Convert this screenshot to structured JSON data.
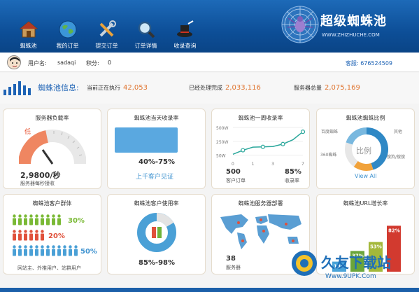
{
  "nav": [
    {
      "label": "蜘蛛池",
      "icon": "house-icon"
    },
    {
      "label": "我的订单",
      "icon": "globe-icon"
    },
    {
      "label": "提交订单",
      "icon": "tools-icon"
    },
    {
      "label": "订单详情",
      "icon": "magnifier-icon"
    },
    {
      "label": "收录查询",
      "icon": "magic-hat-icon"
    }
  ],
  "brand": {
    "title": "超级蜘蛛池",
    "url": "WWW.ZHIZHUCHE.COM"
  },
  "user": {
    "name_label": "用户名:",
    "name": "sadaqi",
    "points_label": "积分:",
    "points": "0",
    "service_label": "客服:",
    "service_qq": "676524509"
  },
  "info": {
    "title": "蜘蛛池信息:",
    "running_label": "当前正在执行",
    "running": "42,053",
    "done_label": "已经处理完成",
    "done": "2,033,116",
    "total_label": "服务器总量",
    "total": "2,075,169"
  },
  "cards": {
    "load": {
      "title": "服务器负载率",
      "level": "低",
      "value": "2,9800/秒",
      "sub": "服务器每秒接收"
    },
    "daily": {
      "title": "蜘蛛池当天收录率",
      "range": "40%-75%",
      "link": "上千客户见证"
    },
    "weekly": {
      "title": "蜘蛛池一周收录率",
      "orders": "500",
      "orders_label": "客户订单",
      "rate": "85%",
      "rate_label": "收录率"
    },
    "ratio": {
      "title": "蜘蛛池蜘蛛比例",
      "center": "比例",
      "l1": "百度蜘蛛",
      "l2": "其他",
      "l3": "360蜘蛛",
      "l4": "搜狗/搜搜",
      "link": "View All"
    },
    "groups": {
      "title": "蜘蛛池客户群体",
      "p1": "30%",
      "p2": "20%",
      "p3": "50%",
      "sub": "网站主、外推用户、站群用户"
    },
    "usage": {
      "title": "蜘蛛池客户使用率",
      "range": "85%-98%"
    },
    "servers": {
      "title": "蜘蛛池服务器部署",
      "count": "38",
      "count_label": "服务器"
    },
    "url": {
      "title": "蜘蛛池URL增长率"
    }
  },
  "chart_data": [
    {
      "type": "line",
      "title": "蜘蛛池一周收录率",
      "x": [
        0,
        1,
        2,
        3,
        4,
        5,
        6,
        7
      ],
      "xticks": [
        "0",
        "1",
        "3",
        "7"
      ],
      "yticks": [
        "500W",
        "250W",
        "50W"
      ],
      "values": [
        65,
        130,
        180,
        185,
        190,
        230,
        300,
        430
      ],
      "ylim": [
        0,
        500
      ],
      "color": "#2aa79b"
    },
    {
      "type": "bar",
      "title": "蜘蛛池URL增长率",
      "categories": [
        "1",
        "2",
        "3",
        "4"
      ],
      "values": [
        18,
        37,
        53,
        82
      ],
      "labels": [
        "18%",
        "37%",
        "53%",
        "82%"
      ],
      "colors": [
        "#4aa3d8",
        "#6aa53a",
        "#a4b83a",
        "#d23a2f"
      ],
      "ylim": [
        0,
        100
      ]
    },
    {
      "type": "pie",
      "title": "蜘蛛池蜘蛛比例",
      "labels": [
        "百度蜘蛛",
        "其他",
        "360蜘蛛",
        "搜狗/搜搜"
      ],
      "values": [
        45,
        15,
        20,
        20
      ],
      "colors": [
        "#2f88c5",
        "#f1a23a",
        "#e7e7e7",
        "#79b8df"
      ]
    }
  ]
}
